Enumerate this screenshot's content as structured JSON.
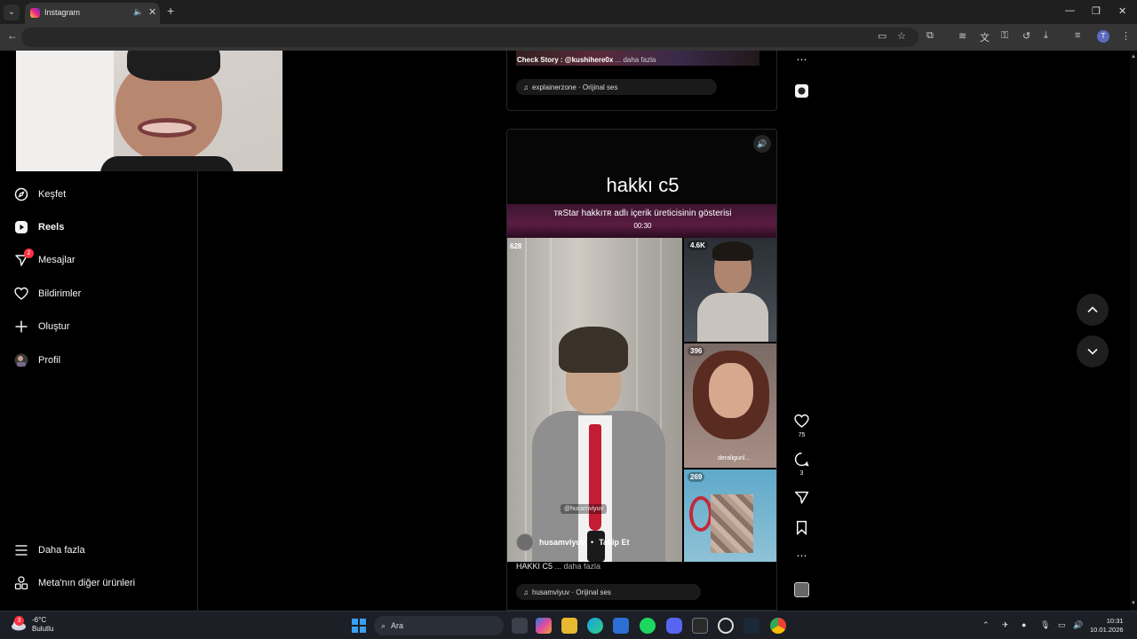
{
  "browser": {
    "tab_title": "Instagram",
    "icons": {
      "back": "back-arrow-icon",
      "cast": "cast-icon",
      "star": "bookmark-star-icon",
      "extensions": "extensions-icon",
      "profile_initial": "T"
    }
  },
  "sidebar": {
    "items": [
      {
        "label": "Keşfet",
        "icon": "compass-icon"
      },
      {
        "label": "Reels",
        "icon": "reels-icon"
      },
      {
        "label": "Mesajlar",
        "icon": "messenger-icon",
        "badge": "2"
      },
      {
        "label": "Bildirimler",
        "icon": "heart-icon"
      },
      {
        "label": "Oluştur",
        "icon": "plus-icon"
      },
      {
        "label": "Profil",
        "icon": "profile-avatar"
      }
    ],
    "bottom": [
      {
        "label": "Daha fazla",
        "icon": "menu-icon"
      },
      {
        "label": "Meta'nın diğer ürünleri",
        "icon": "meta-apps-icon"
      }
    ]
  },
  "post_top": {
    "strip_text": "Check Story",
    "strip_handle": ": @kushihere0x",
    "strip_more": "... daha fazla",
    "audio": "explainerzone · Orijinal ses"
  },
  "post_main": {
    "title": "hakkı c5",
    "live_line": "ᴛʀStar hakkıᴛʀ adlı içerik üreticisinin gösterisi",
    "live_timer": "00:30",
    "main_viewers": "628",
    "main_handle_tag": "@husamviyuv",
    "cams": [
      {
        "count": "4.6K"
      },
      {
        "count": "396",
        "name": "deraligunl..."
      },
      {
        "count": "269"
      }
    ],
    "username": "husamviyuv",
    "follow": "Takip Et",
    "caption": "HAKKI C5",
    "caption_more": "... daha fazla",
    "audio": "husamviyuv · Orijinal ses"
  },
  "actions": {
    "likes": "75",
    "comments": "3"
  },
  "taskbar": {
    "temp": "-6°C",
    "weather": "Bulutlu",
    "weather_badge": "3",
    "search": "Ara",
    "time": "10:31",
    "date": "10.01.2026"
  }
}
